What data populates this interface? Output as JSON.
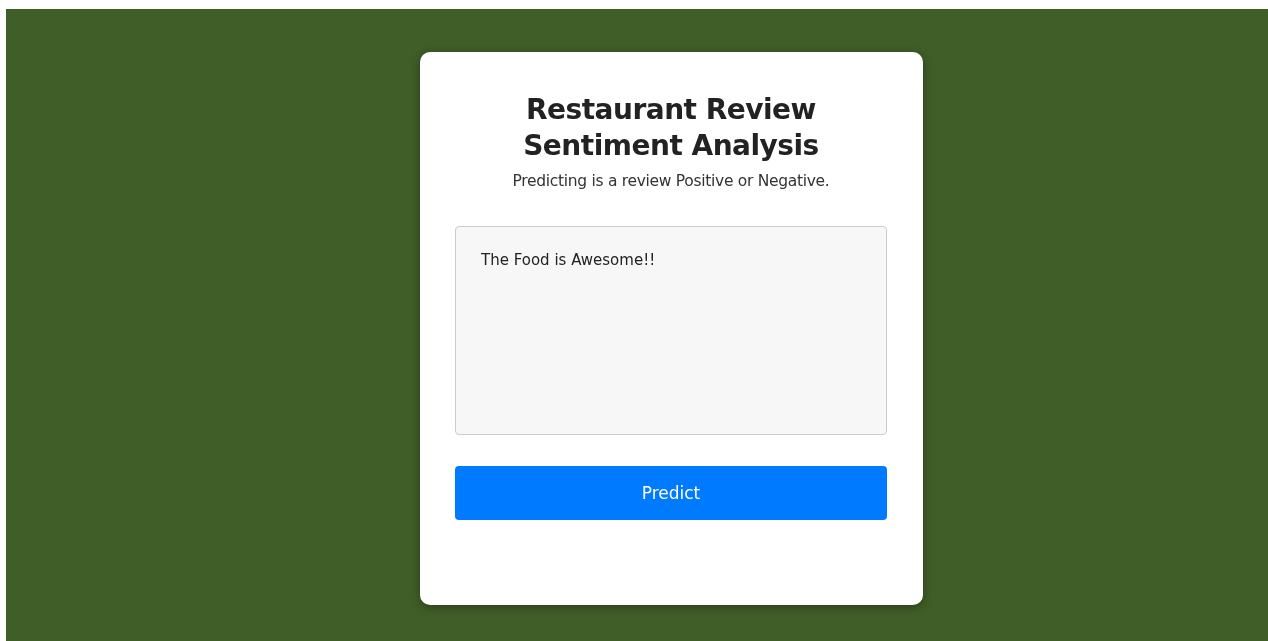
{
  "card": {
    "title": "Restaurant Review Sentiment Analysis",
    "subtitle": "Predicting is a review Positive or Negative."
  },
  "review_field": {
    "value": "The Food is Awesome!!"
  },
  "predict_button": {
    "label": "Predict"
  }
}
